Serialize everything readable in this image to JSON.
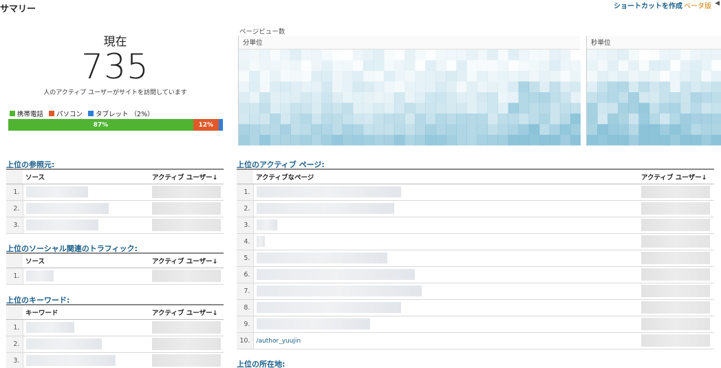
{
  "header": {
    "title": "サマリー",
    "shortcut_label": "ショートカットを作成",
    "beta_label": "ベータ版"
  },
  "realtime": {
    "now_label": "現在",
    "active_count": "735",
    "subtext": "人のアクティブ ユーザーがサイトを訪問しています"
  },
  "devices": {
    "legend": [
      {
        "label": "携帯電話",
        "color": "#50b432"
      },
      {
        "label": "パソコン",
        "color": "#e0592a"
      },
      {
        "label": "タブレット （2%）",
        "color": "#2f7ed8"
      }
    ],
    "bar": [
      {
        "label": "87%",
        "share": 87,
        "color": "#50b432"
      },
      {
        "label": "12%",
        "share": 12,
        "color": "#e0592a"
      },
      {
        "label": "",
        "share": 2,
        "color": "#2f7ed8"
      }
    ]
  },
  "pageviews": {
    "title": "ページビュー数",
    "per_minute_label": "分単位",
    "per_second_label": "秒単位"
  },
  "referrers": {
    "title": "上位の参照元:",
    "col_source": "ソース",
    "col_users": "アクティブ ユーザー↓",
    "rows": [
      "1.",
      "2.",
      "3."
    ]
  },
  "social": {
    "title": "上位のソーシャル関連のトラフィック:",
    "col_source": "ソース",
    "col_users": "アクティブ ユーザー↓",
    "rows": [
      "1."
    ]
  },
  "keywords": {
    "title": "上位のキーワード:",
    "col_keyword": "キーワード",
    "col_users": "アクティブ ユーザー↓",
    "rows": [
      "1.",
      "2.",
      "3."
    ]
  },
  "active_pages": {
    "title": "上位のアクティブ ページ:",
    "col_page": "アクティブなページ",
    "col_users": "アクティブ ユーザー↓",
    "rows": [
      "1.",
      "2.",
      "3.",
      "4.",
      "5.",
      "6.",
      "7.",
      "8.",
      "9.",
      "10."
    ],
    "last_page": "/author_yuujin"
  },
  "location": {
    "title": "上位の所在地:"
  }
}
